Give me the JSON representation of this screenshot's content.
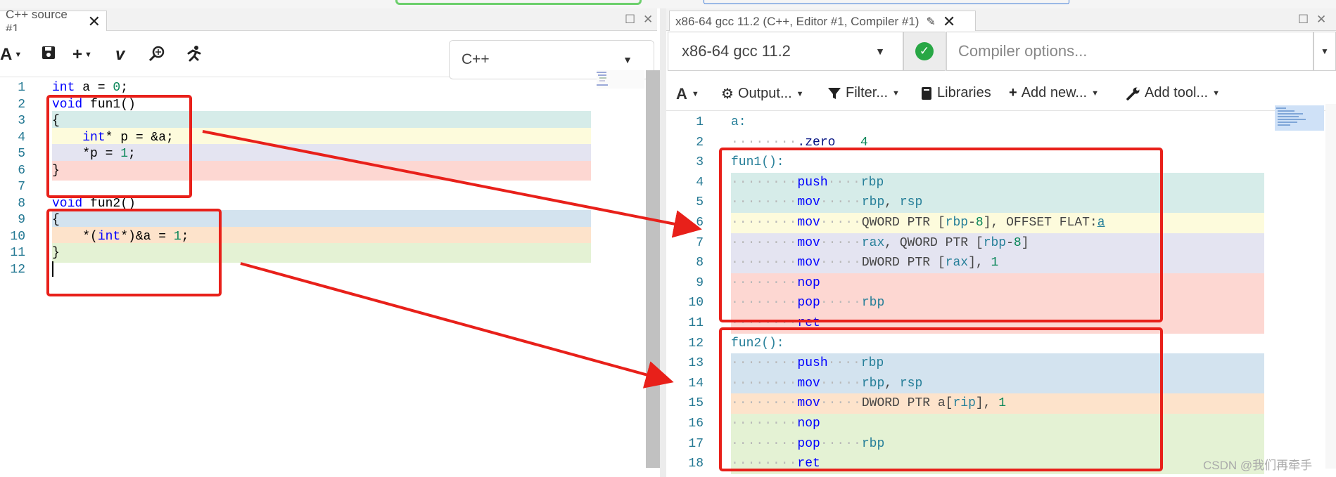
{
  "left_pane": {
    "tab_title": "C++ source #1",
    "toolbar": {
      "font_btn": "A",
      "plus_btn": "+",
      "vim_btn": "v"
    },
    "language": "C++",
    "lines": [
      {
        "n": "1",
        "parts": [
          [
            "kw",
            "int"
          ],
          [
            "t",
            " a = "
          ],
          [
            "numlit",
            "0"
          ],
          [
            "t",
            ";"
          ]
        ]
      },
      {
        "n": "2",
        "parts": [
          [
            "kw",
            "void"
          ],
          [
            "t",
            " fun1()"
          ]
        ]
      },
      {
        "n": "3",
        "parts": [
          [
            "t",
            "{"
          ]
        ]
      },
      {
        "n": "4",
        "parts": [
          [
            "t",
            "    "
          ],
          [
            "kw",
            "int"
          ],
          [
            "t",
            "* p = &a;"
          ]
        ]
      },
      {
        "n": "5",
        "parts": [
          [
            "t",
            "    *p = "
          ],
          [
            "numlit",
            "1"
          ],
          [
            "t",
            ";"
          ]
        ]
      },
      {
        "n": "6",
        "parts": [
          [
            "t",
            "}"
          ]
        ]
      },
      {
        "n": "7",
        "parts": []
      },
      {
        "n": "8",
        "parts": [
          [
            "kw",
            "void"
          ],
          [
            "t",
            " fun2()"
          ]
        ]
      },
      {
        "n": "9",
        "parts": [
          [
            "t",
            "{"
          ]
        ]
      },
      {
        "n": "10",
        "parts": [
          [
            "t",
            "    *("
          ],
          [
            "kw",
            "int"
          ],
          [
            "t",
            "*)&a = "
          ],
          [
            "numlit",
            "1"
          ],
          [
            "t",
            ";"
          ]
        ]
      },
      {
        "n": "11",
        "parts": [
          [
            "t",
            "}"
          ]
        ]
      },
      {
        "n": "12",
        "parts": []
      }
    ],
    "line_bg": [
      "",
      "",
      "#d6ece9",
      "#fdfbdc",
      "#e4e4f1",
      "#fdd7d2",
      "",
      "",
      "#d3e3ef",
      "#fde3cb",
      "#e4f2d4",
      ""
    ]
  },
  "right_pane": {
    "tab_title": "x86-64 gcc 11.2 (C++, Editor #1, Compiler #1)",
    "compiler": "x86-64 gcc 11.2",
    "options_placeholder": "Compiler options...",
    "output_bar": {
      "font_btn": "A",
      "output": "Output...",
      "filter": "Filter...",
      "libraries": "Libraries",
      "add_new": "Add new...",
      "add_tool": "Add tool..."
    },
    "lines": [
      {
        "n": "1",
        "parts": [
          [
            "lbl",
            "a:"
          ]
        ]
      },
      {
        "n": "2",
        "parts": [
          [
            "dots",
            "········"
          ],
          [
            "dir",
            ".zero"
          ],
          [
            "dots",
            "   "
          ],
          [
            "lit",
            "4"
          ]
        ]
      },
      {
        "n": "3",
        "parts": [
          [
            "lbl",
            "fun1():"
          ]
        ]
      },
      {
        "n": "4",
        "parts": [
          [
            "dots",
            "········"
          ],
          [
            "ins",
            "push"
          ],
          [
            "dots",
            "····"
          ],
          [
            "reg",
            "rbp"
          ]
        ]
      },
      {
        "n": "5",
        "parts": [
          [
            "dots",
            "········"
          ],
          [
            "ins",
            "mov"
          ],
          [
            "dots",
            "·····"
          ],
          [
            "reg",
            "rbp"
          ],
          [
            "asm",
            ", "
          ],
          [
            "reg",
            "rsp"
          ]
        ]
      },
      {
        "n": "6",
        "parts": [
          [
            "dots",
            "········"
          ],
          [
            "ins",
            "mov"
          ],
          [
            "dots",
            "·····"
          ],
          [
            "asm",
            "QWORD PTR ["
          ],
          [
            "reg",
            "rbp"
          ],
          [
            "asm",
            "-"
          ],
          [
            "lit",
            "8"
          ],
          [
            "asm",
            "], OFFSET FLAT:"
          ],
          [
            "sym",
            "a"
          ]
        ]
      },
      {
        "n": "7",
        "parts": [
          [
            "dots",
            "········"
          ],
          [
            "ins",
            "mov"
          ],
          [
            "dots",
            "·····"
          ],
          [
            "reg",
            "rax"
          ],
          [
            "asm",
            ", QWORD PTR ["
          ],
          [
            "reg",
            "rbp"
          ],
          [
            "asm",
            "-"
          ],
          [
            "lit",
            "8"
          ],
          [
            "asm",
            "]"
          ]
        ]
      },
      {
        "n": "8",
        "parts": [
          [
            "dots",
            "········"
          ],
          [
            "ins",
            "mov"
          ],
          [
            "dots",
            "·····"
          ],
          [
            "asm",
            "DWORD PTR ["
          ],
          [
            "reg",
            "rax"
          ],
          [
            "asm",
            "], "
          ],
          [
            "lit",
            "1"
          ]
        ]
      },
      {
        "n": "9",
        "parts": [
          [
            "dots",
            "········"
          ],
          [
            "ins",
            "nop"
          ]
        ]
      },
      {
        "n": "10",
        "parts": [
          [
            "dots",
            "········"
          ],
          [
            "ins",
            "pop"
          ],
          [
            "dots",
            "·····"
          ],
          [
            "reg",
            "rbp"
          ]
        ]
      },
      {
        "n": "11",
        "parts": [
          [
            "dots",
            "········"
          ],
          [
            "ins",
            "ret"
          ]
        ]
      },
      {
        "n": "12",
        "parts": [
          [
            "lbl",
            "fun2():"
          ]
        ]
      },
      {
        "n": "13",
        "parts": [
          [
            "dots",
            "········"
          ],
          [
            "ins",
            "push"
          ],
          [
            "dots",
            "····"
          ],
          [
            "reg",
            "rbp"
          ]
        ]
      },
      {
        "n": "14",
        "parts": [
          [
            "dots",
            "········"
          ],
          [
            "ins",
            "mov"
          ],
          [
            "dots",
            "·····"
          ],
          [
            "reg",
            "rbp"
          ],
          [
            "asm",
            ", "
          ],
          [
            "reg",
            "rsp"
          ]
        ]
      },
      {
        "n": "15",
        "parts": [
          [
            "dots",
            "········"
          ],
          [
            "ins",
            "mov"
          ],
          [
            "dots",
            "·····"
          ],
          [
            "asm",
            "DWORD PTR a["
          ],
          [
            "reg",
            "rip"
          ],
          [
            "asm",
            "], "
          ],
          [
            "lit",
            "1"
          ]
        ]
      },
      {
        "n": "16",
        "parts": [
          [
            "dots",
            "········"
          ],
          [
            "ins",
            "nop"
          ]
        ]
      },
      {
        "n": "17",
        "parts": [
          [
            "dots",
            "········"
          ],
          [
            "ins",
            "pop"
          ],
          [
            "dots",
            "·····"
          ],
          [
            "reg",
            "rbp"
          ]
        ]
      },
      {
        "n": "18",
        "parts": [
          [
            "dots",
            "········"
          ],
          [
            "ins",
            "ret"
          ]
        ]
      }
    ],
    "line_bg": [
      "",
      "",
      "",
      "#d6ece9",
      "#d6ece9",
      "#fdfbdc",
      "#e4e4f1",
      "#e4e4f1",
      "#fdd7d2",
      "#fdd7d2",
      "#fdd7d2",
      "",
      "#d3e3ef",
      "#d3e3ef",
      "#fde3cb",
      "#e4f2d4",
      "#e4f2d4",
      "#e4f2d4"
    ]
  },
  "watermark": "CSDN @我们再牵手",
  "annotation_color": "#e8201a"
}
